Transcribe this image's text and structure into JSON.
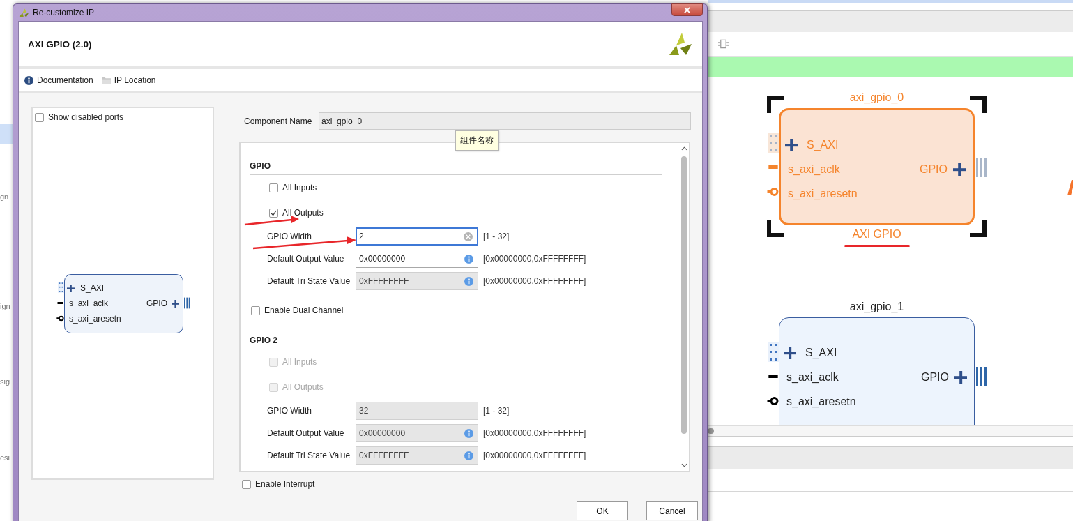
{
  "background": {
    "sidebar_fragments": [
      "gn",
      "ign",
      "sig",
      "esi"
    ]
  },
  "canvas": {
    "blocks": [
      {
        "name": "axi_gpio_0",
        "subtitle": "AXI GPIO",
        "selected": true,
        "left_ports": [
          {
            "name": "S_AXI",
            "kind": "bus"
          },
          {
            "name": "s_axi_aclk",
            "kind": "clock"
          },
          {
            "name": "s_axi_aresetn",
            "kind": "reset"
          }
        ],
        "right_ports": [
          {
            "name": "GPIO",
            "kind": "bus"
          }
        ]
      },
      {
        "name": "axi_gpio_1",
        "selected": false,
        "left_ports": [
          {
            "name": "S_AXI",
            "kind": "bus"
          },
          {
            "name": "s_axi_aclk",
            "kind": "clock"
          },
          {
            "name": "s_axi_aresetn",
            "kind": "reset"
          }
        ],
        "right_ports": [
          {
            "name": "GPIO",
            "kind": "bus"
          }
        ]
      }
    ]
  },
  "dialog": {
    "title": "Re-customize IP",
    "heading": "AXI GPIO (2.0)",
    "links": [
      {
        "label": "Documentation",
        "kind": "info"
      },
      {
        "label": "IP Location",
        "kind": "folder"
      }
    ],
    "show_disabled_ports": {
      "label": "Show disabled ports",
      "checked": false
    },
    "symbol": {
      "left_ports": [
        {
          "name": "S_AXI",
          "kind": "bus"
        },
        {
          "name": "s_axi_aclk",
          "kind": "clock"
        },
        {
          "name": "s_axi_aresetn",
          "kind": "reset"
        }
      ],
      "right_ports": [
        {
          "name": "GPIO",
          "kind": "bus"
        }
      ]
    },
    "component_name": {
      "label": "Component Name",
      "value": "axi_gpio_0"
    },
    "tooltip": "组件名称",
    "panel_items": [
      {
        "kind": "heading",
        "label": "GPIO"
      },
      {
        "kind": "option",
        "label": "All Inputs",
        "checked": false,
        "disabled": false
      },
      {
        "kind": "option",
        "label": "All Outputs",
        "checked": true,
        "disabled": false
      },
      {
        "kind": "field",
        "label": "GPIO Width",
        "value": "2",
        "range": "[1 - 32]",
        "icon": {
          "kind": "clear"
        },
        "disabled": false,
        "focused": true
      },
      {
        "kind": "field",
        "label": "Default Output Value",
        "value": "0x00000000",
        "range": "[0x00000000,0xFFFFFFFF]",
        "icon": {
          "kind": "info"
        },
        "disabled": false,
        "focused": false
      },
      {
        "kind": "field",
        "label": "Default Tri State Value",
        "value": "0xFFFFFFFF",
        "range": "[0x00000000,0xFFFFFFFF]",
        "icon": {
          "kind": "info"
        },
        "disabled": true,
        "focused": false
      },
      {
        "kind": "checkbox",
        "label": "Enable Dual Channel",
        "checked": false,
        "disabled": false
      },
      {
        "kind": "heading",
        "label": "GPIO 2"
      },
      {
        "kind": "option",
        "label": "All Inputs",
        "checked": false,
        "disabled": true
      },
      {
        "kind": "option",
        "label": "All Outputs",
        "checked": false,
        "disabled": true
      },
      {
        "kind": "field",
        "label": "GPIO Width",
        "value": "32",
        "range": "[1 - 32]",
        "disabled": true,
        "focused": false
      },
      {
        "kind": "field",
        "label": "Default Output Value",
        "value": "0x00000000",
        "range": "[0x00000000,0xFFFFFFFF]",
        "icon": {
          "kind": "info"
        },
        "disabled": true,
        "focused": false
      },
      {
        "kind": "field",
        "label": "Default Tri State Value",
        "value": "0xFFFFFFFF",
        "range": "[0x00000000,0xFFFFFFFF]",
        "icon": {
          "kind": "info"
        },
        "disabled": true,
        "focused": false
      }
    ],
    "enable_interrupt": {
      "label": "Enable Interrupt",
      "checked": false
    },
    "buttons": [
      "OK",
      "Cancel"
    ]
  }
}
